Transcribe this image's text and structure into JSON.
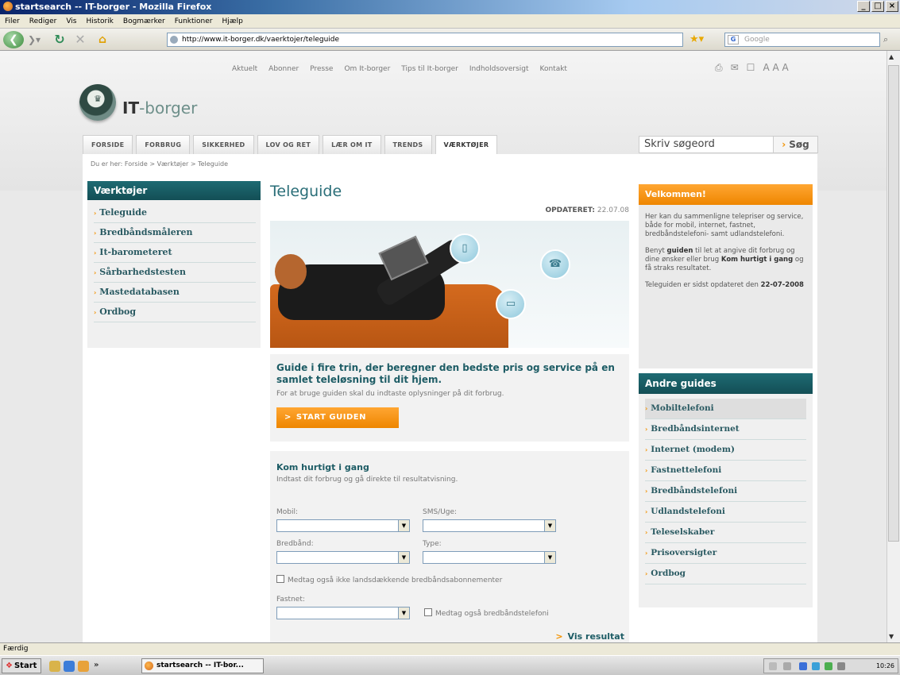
{
  "window": {
    "title": "startsearch -- IT-borger - Mozilla Firefox",
    "controls": [
      "_",
      "□",
      "×"
    ]
  },
  "menubar": [
    "Filer",
    "Rediger",
    "Vis",
    "Historik",
    "Bogmærker",
    "Funktioner",
    "Hjælp"
  ],
  "toolbar": {
    "url": "http://www.it-borger.dk/vaerktojer/teleguide",
    "search_placeholder": "Google"
  },
  "site": {
    "logo_bold": "IT",
    "logo_rest": "-borger",
    "top_links": [
      "Aktuelt",
      "Abonner",
      "Presse",
      "Om It-borger",
      "Tips til It-borger",
      "Indholdsoversigt",
      "Kontakt"
    ],
    "font_tools": [
      "⎙",
      "✉",
      "✉",
      "A A A"
    ],
    "tabs": [
      "FORSIDE",
      "FORBRUG",
      "SIKKERHED",
      "LOV OG RET",
      "LÆR OM IT",
      "TRENDS",
      "VÆRKTØJER"
    ],
    "active_tab": "VÆRKTØJER",
    "search_placeholder": "Skriv søgeord",
    "search_button": "Søg",
    "breadcrumb": "Du er her: Forside > Værktøjer > Teleguide"
  },
  "leftnav": {
    "title": "Værktøjer",
    "items": [
      "Teleguide",
      "Bredbåndsmåleren",
      "It-barometeret",
      "Sårbarhedstesten",
      "Mastedatabasen",
      "Ordbog"
    ]
  },
  "main": {
    "title": "Teleguide",
    "updated_label": "OPDATERET:",
    "updated_date": "22.07.08",
    "guide_heading": "Guide i fire trin, der beregner den bedste pris og service på en samlet teleløsning til dit hjem.",
    "guide_text": "For at bruge guiden skal du indtaste oplysninger på dit forbrug.",
    "start_button": "START GUIDEN",
    "quick_heading": "Kom hurtigt i gang",
    "quick_text": "Indtast dit forbrug og gå direkte til resultatvisning.",
    "fields": {
      "mobil": "Mobil:",
      "sms": "SMS/Uge:",
      "bredbaand": "Bredbånd:",
      "type": "Type:",
      "fastnet": "Fastnet:"
    },
    "checkbox1": "Medtag også ikke landsdækkende bredbåndsabonnementer",
    "checkbox2": "Medtag også bredbåndstelefoni",
    "result_link": "Vis resultat"
  },
  "right": {
    "welcome_title": "Velkommen!",
    "welcome_p1": "Her kan du sammenligne telepriser og service, både for mobil, internet, fastnet, bredbåndstelefoni- samt udlandstelefoni.",
    "welcome_p2_a": "Benyt ",
    "welcome_p2_b": "guiden",
    "welcome_p2_c": " til let at angive dit forbrug og dine ønsker eller brug ",
    "welcome_p2_d": "Kom hurtigt i gang",
    "welcome_p2_e": " og få straks resultatet.",
    "welcome_p3": "Teleguiden er sidst opdateret den ",
    "welcome_date": "22-07-2008",
    "other_title": "Andre guides",
    "other_items": [
      "Mobiltelefoni",
      "Bredbåndsinternet",
      "Internet (modem)",
      "Fastnettelefoni",
      "Bredbåndstelefoni",
      "Udlandstelefoni",
      "Teleselskaber",
      "Prisoversigter",
      "Ordbog"
    ]
  },
  "status": "Færdig",
  "taskbar": {
    "start": "Start",
    "task": "startsearch -- IT-bor...",
    "clock": "10:26"
  }
}
